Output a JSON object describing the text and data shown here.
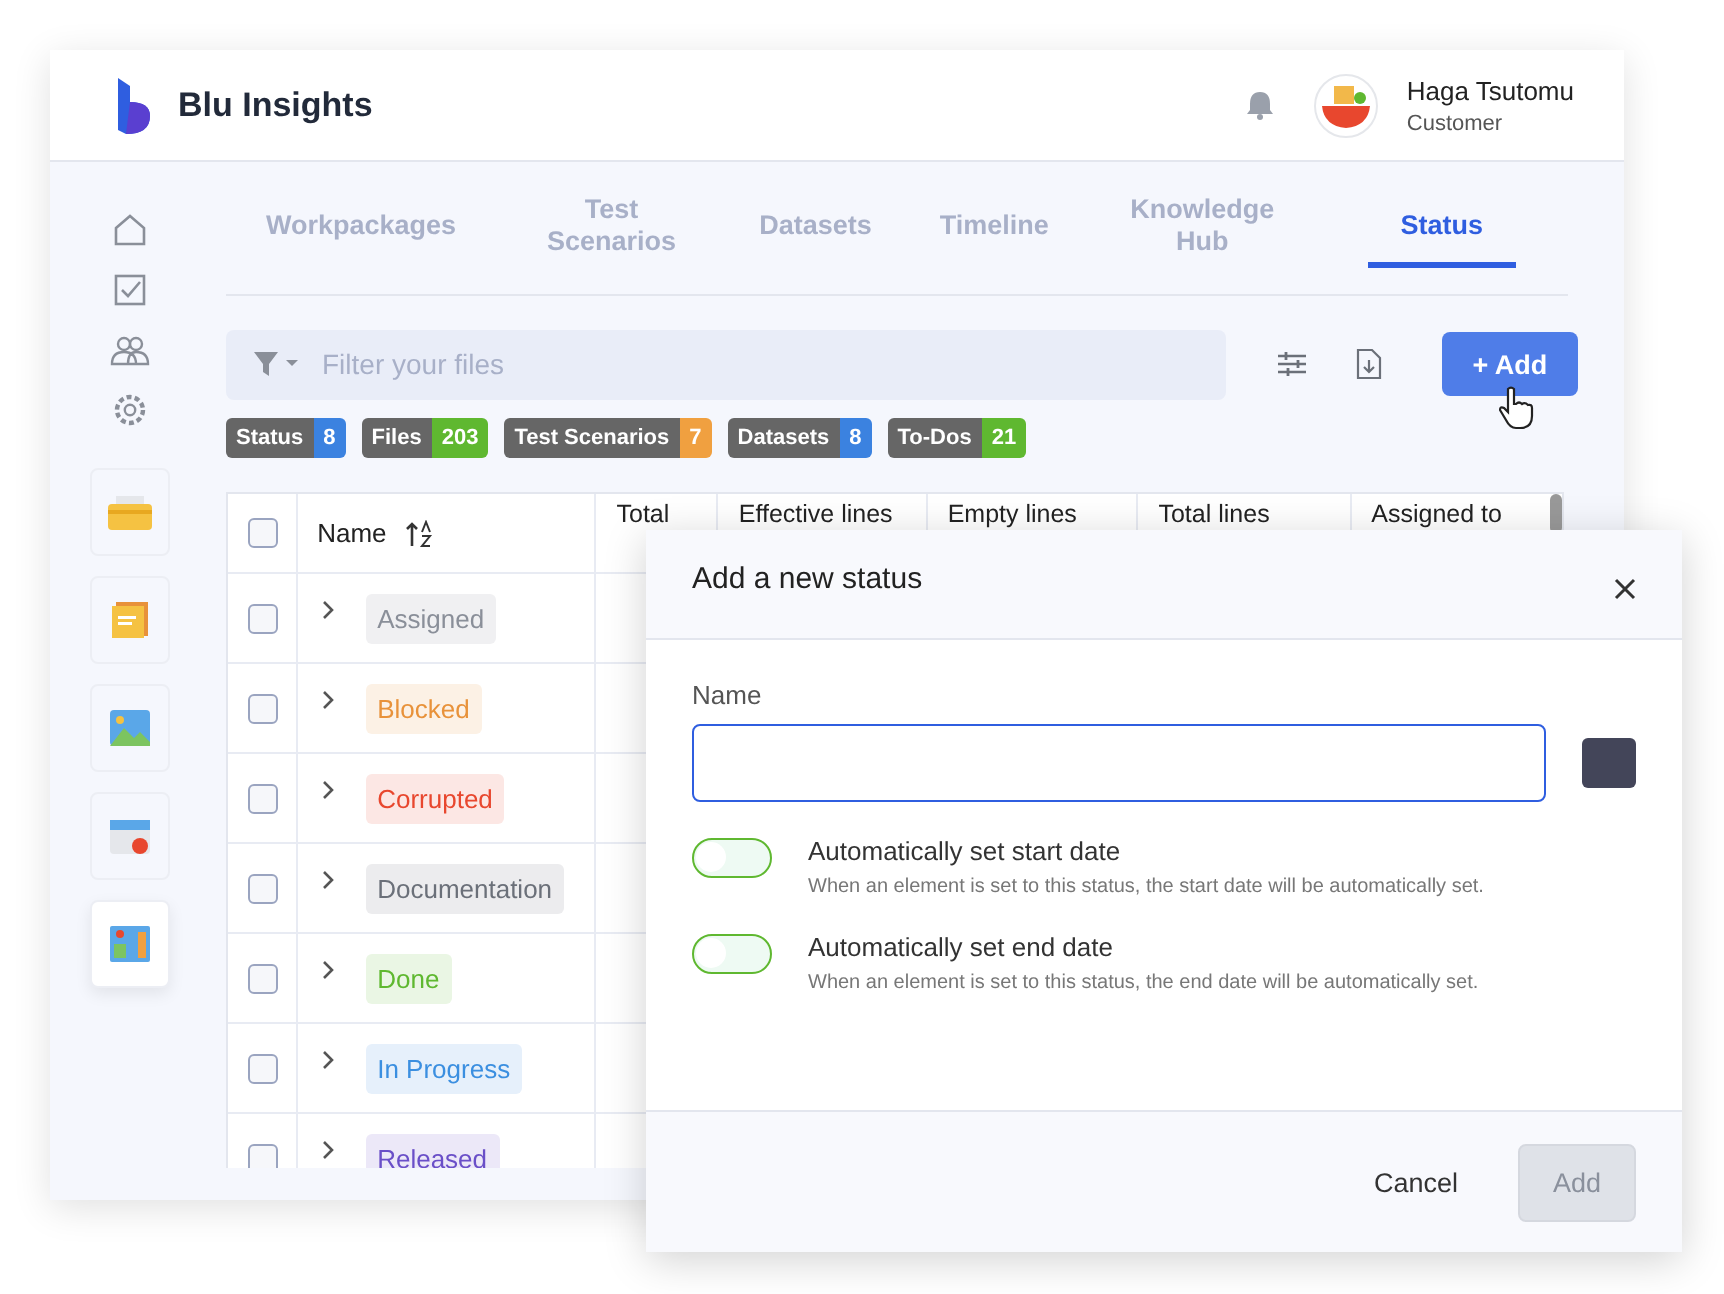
{
  "app": {
    "name": "Blu Insights"
  },
  "user": {
    "name": "Haga Tsutomu",
    "role": "Customer"
  },
  "tabs": [
    {
      "label": "Workpackages",
      "selected": false
    },
    {
      "label": "Test Scenarios",
      "selected": false
    },
    {
      "label": "Datasets",
      "selected": false
    },
    {
      "label": "Timeline",
      "selected": false
    },
    {
      "label": "Knowledge Hub",
      "selected": false
    },
    {
      "label": "Status",
      "selected": true
    }
  ],
  "search": {
    "placeholder": "Filter your files"
  },
  "add_button": "+ Add",
  "counters": [
    {
      "label": "Status",
      "count": "8",
      "color": "#3b82e0"
    },
    {
      "label": "Files",
      "count": "203",
      "color": "#5fb830"
    },
    {
      "label": "Test Scenarios",
      "count": "7",
      "color": "#f0a040"
    },
    {
      "label": "Datasets",
      "count": "8",
      "color": "#3b82e0"
    },
    {
      "label": "To-Dos",
      "count": "21",
      "color": "#5fb830"
    }
  ],
  "table": {
    "header_checked": false,
    "columns": [
      "Name",
      "Total",
      "Effective lines",
      "Empty lines",
      "Total lines",
      "Assigned to"
    ],
    "rows": [
      {
        "name": "Assigned",
        "color": "#8a8f99",
        "checked": false
      },
      {
        "name": "Blocked",
        "color": "#e8923a",
        "checked": false
      },
      {
        "name": "Corrupted",
        "color": "#e8472e",
        "checked": false
      },
      {
        "name": "Documentation",
        "color": "#6b7079",
        "checked": false
      },
      {
        "name": "Done",
        "color": "#5fb830",
        "checked": false
      },
      {
        "name": "In Progress",
        "color": "#3b8fe0",
        "checked": false
      },
      {
        "name": "Released",
        "color": "#6a4fc8",
        "checked": false
      }
    ]
  },
  "dialog": {
    "title": "Add a new status",
    "field_label": "Name",
    "options": [
      {
        "label": "Automatically set start date",
        "hint": "When an element is set to this status, the start date will be automatically set.",
        "on": false
      },
      {
        "label": "Automatically set end date",
        "hint": "When an element is set to this status, the end date will be automatically set.",
        "on": false
      }
    ],
    "cancel": "Cancel",
    "submit": "Add",
    "submit_disabled": true
  }
}
